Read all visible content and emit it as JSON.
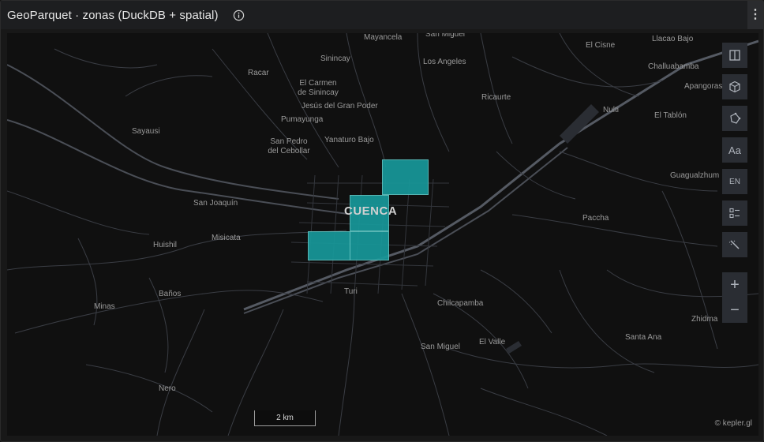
{
  "header": {
    "title": "GeoParquet · zonas (DuckDB + spatial)",
    "info_icon": "info-icon",
    "menu_icon": "kebab-menu-icon"
  },
  "map": {
    "place_labels": [
      {
        "name": "Mayancela",
        "key": "mayancela"
      },
      {
        "name": "San Miguel",
        "key": "san-miguel-north"
      },
      {
        "name": "Sinincay",
        "key": "sinincay"
      },
      {
        "name": "Los Angeles",
        "key": "los-angeles"
      },
      {
        "name": "El Cisne",
        "key": "el-cisne"
      },
      {
        "name": "Llacao Bajo",
        "key": "llacao-bajo"
      },
      {
        "name": "Racar",
        "key": "racar"
      },
      {
        "name": "Challuabamba",
        "key": "challuabamba"
      },
      {
        "name": "El Carmen de Sinincay",
        "key": "el-carmen"
      },
      {
        "name": "Apangoras",
        "key": "apangoras"
      },
      {
        "name": "Ricaurte",
        "key": "ricaurte"
      },
      {
        "name": "Jesús del Gran Poder",
        "key": "jesus-gran-poder"
      },
      {
        "name": "Nulti",
        "key": "nulti"
      },
      {
        "name": "El Tablón",
        "key": "el-tablon"
      },
      {
        "name": "Pumayunga",
        "key": "pumayunga"
      },
      {
        "name": "Sayausi",
        "key": "sayausi"
      },
      {
        "name": "San Pedro del Cebollar",
        "key": "san-pedro"
      },
      {
        "name": "Yanaturo Bajo",
        "key": "yanaturo-bajo"
      },
      {
        "name": "Guagualzhum",
        "key": "guagualzhum"
      },
      {
        "name": "San Joaquín",
        "key": "san-joaquin"
      },
      {
        "name": "Paccha",
        "key": "paccha"
      },
      {
        "name": "Misicata",
        "key": "misicata"
      },
      {
        "name": "Huishil",
        "key": "huishil"
      },
      {
        "name": "Turi",
        "key": "turi"
      },
      {
        "name": "Baños",
        "key": "banos"
      },
      {
        "name": "Chilcapamba",
        "key": "chilcapamba"
      },
      {
        "name": "Minas",
        "key": "minas"
      },
      {
        "name": "Zhidma",
        "key": "zhidma"
      },
      {
        "name": "Santa Ana",
        "key": "santa-ana"
      },
      {
        "name": "El Valle",
        "key": "el-valle"
      },
      {
        "name": "San Miguel",
        "key": "san-miguel-south"
      },
      {
        "name": "Nero",
        "key": "nero"
      }
    ],
    "city_label": "CUENCA",
    "zone_color": "#17989a",
    "zone_count": 4,
    "scale_label": "2 km",
    "attribution": "© kepler.gl"
  },
  "toolbar": {
    "items": [
      {
        "key": "split-map",
        "icon": "split-map-icon",
        "text": ""
      },
      {
        "key": "3d-view",
        "icon": "cube-icon",
        "text": ""
      },
      {
        "key": "draw",
        "icon": "draw-polygon-icon",
        "text": ""
      },
      {
        "key": "map-labels",
        "icon": "text-icon",
        "text": "Aa"
      },
      {
        "key": "locale",
        "icon": "locale-icon",
        "text": "EN"
      },
      {
        "key": "legend",
        "icon": "legend-icon",
        "text": ""
      },
      {
        "key": "effects",
        "icon": "magic-wand-icon",
        "text": ""
      }
    ],
    "zoom_in": "+",
    "zoom_out": "−"
  }
}
